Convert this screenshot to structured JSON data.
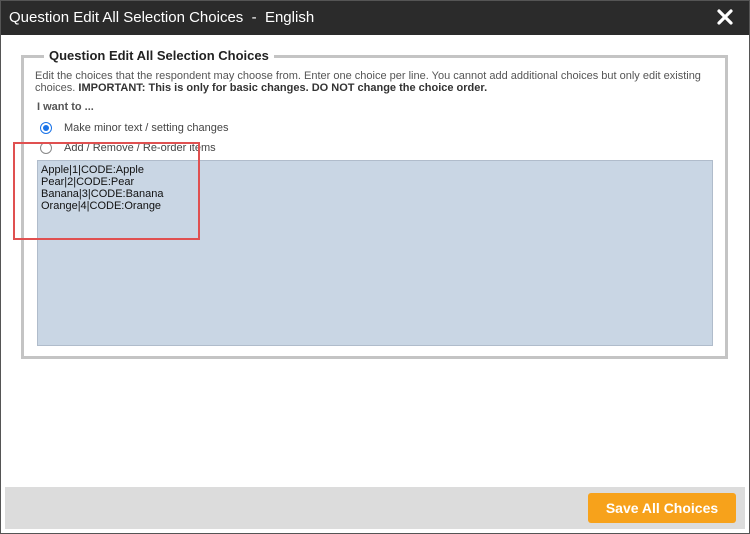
{
  "window": {
    "title": "Question Edit All Selection Choices  -  English",
    "close_icon": "close-icon"
  },
  "panel": {
    "legend": "Question Edit All Selection Choices",
    "instructions_plain": "Edit the choices that the respondent may choose from. Enter one choice per line. You cannot add additional choices but only edit existing choices. ",
    "instructions_important": "IMPORTANT: This is only for basic changes. DO NOT change the choice order.",
    "want_label": "I want to ...",
    "options": [
      {
        "label": "Make minor text / setting changes",
        "selected": true
      },
      {
        "label": "Add / Remove / Re-order items",
        "selected": false
      }
    ],
    "choices_text": "Apple|1|CODE:Apple\nPear|2|CODE:Pear\nBanana|3|CODE:Banana\nOrange|4|CODE:Orange"
  },
  "footer": {
    "save_label": "Save All Choices"
  },
  "colors": {
    "titlebar": "#2b2b2b",
    "accent": "#f7a21b",
    "textarea_bg": "#c9d6e4",
    "radio_selected": "#1a73e8",
    "highlight": "#e05050"
  }
}
